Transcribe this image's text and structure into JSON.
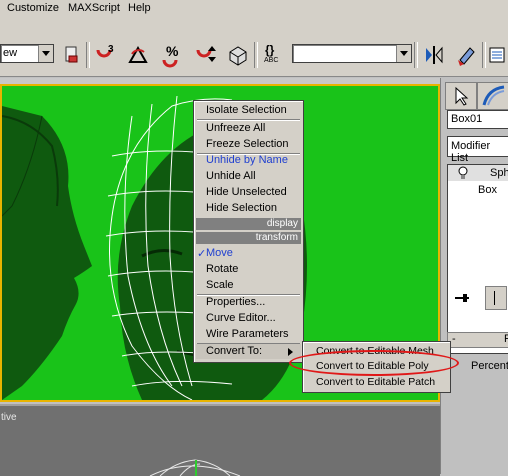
{
  "menubar": {
    "items": [
      "Customize",
      "MAXScript",
      "Help"
    ]
  },
  "toolbar": {
    "view_combo": "ew",
    "selection_set_combo": "",
    "abc_label": "ABC",
    "braces_label": "{}"
  },
  "viewport": {
    "bottom_label": "tive"
  },
  "context_menu": {
    "items": [
      {
        "label": "Isolate Selection"
      },
      {
        "label": "Unfreeze All"
      },
      {
        "label": "Freeze Selection"
      },
      {
        "label": "Unhide by Name"
      },
      {
        "label": "Unhide All"
      },
      {
        "label": "Hide Unselected"
      },
      {
        "label": "Hide Selection"
      },
      {
        "label": "Move"
      },
      {
        "label": "Rotate"
      },
      {
        "label": "Scale"
      },
      {
        "label": "Properties..."
      },
      {
        "label": "Curve Editor..."
      },
      {
        "label": "Wire Parameters"
      },
      {
        "label": "Convert To:"
      }
    ],
    "section_display": "display",
    "section_transform": "transform",
    "checkmark": "✓"
  },
  "submenu": {
    "items": [
      {
        "label": "Convert to Editable Mesh"
      },
      {
        "label": "Convert to Editable Poly"
      },
      {
        "label": "Convert to Editable Patch"
      }
    ]
  },
  "command_panel": {
    "object_name": "Box01",
    "modifier_list": "Modifier List",
    "stack_top": "Sph",
    "stack_base": "Box",
    "rollout_minus": "-",
    "rollout_letter": "F",
    "percent_label": "Percent"
  },
  "colors": {
    "viewport_bg": "#19c319",
    "active_border": "#e8b400",
    "highlight_oval": "#e01818",
    "blue_item": "#1f3fd0"
  }
}
